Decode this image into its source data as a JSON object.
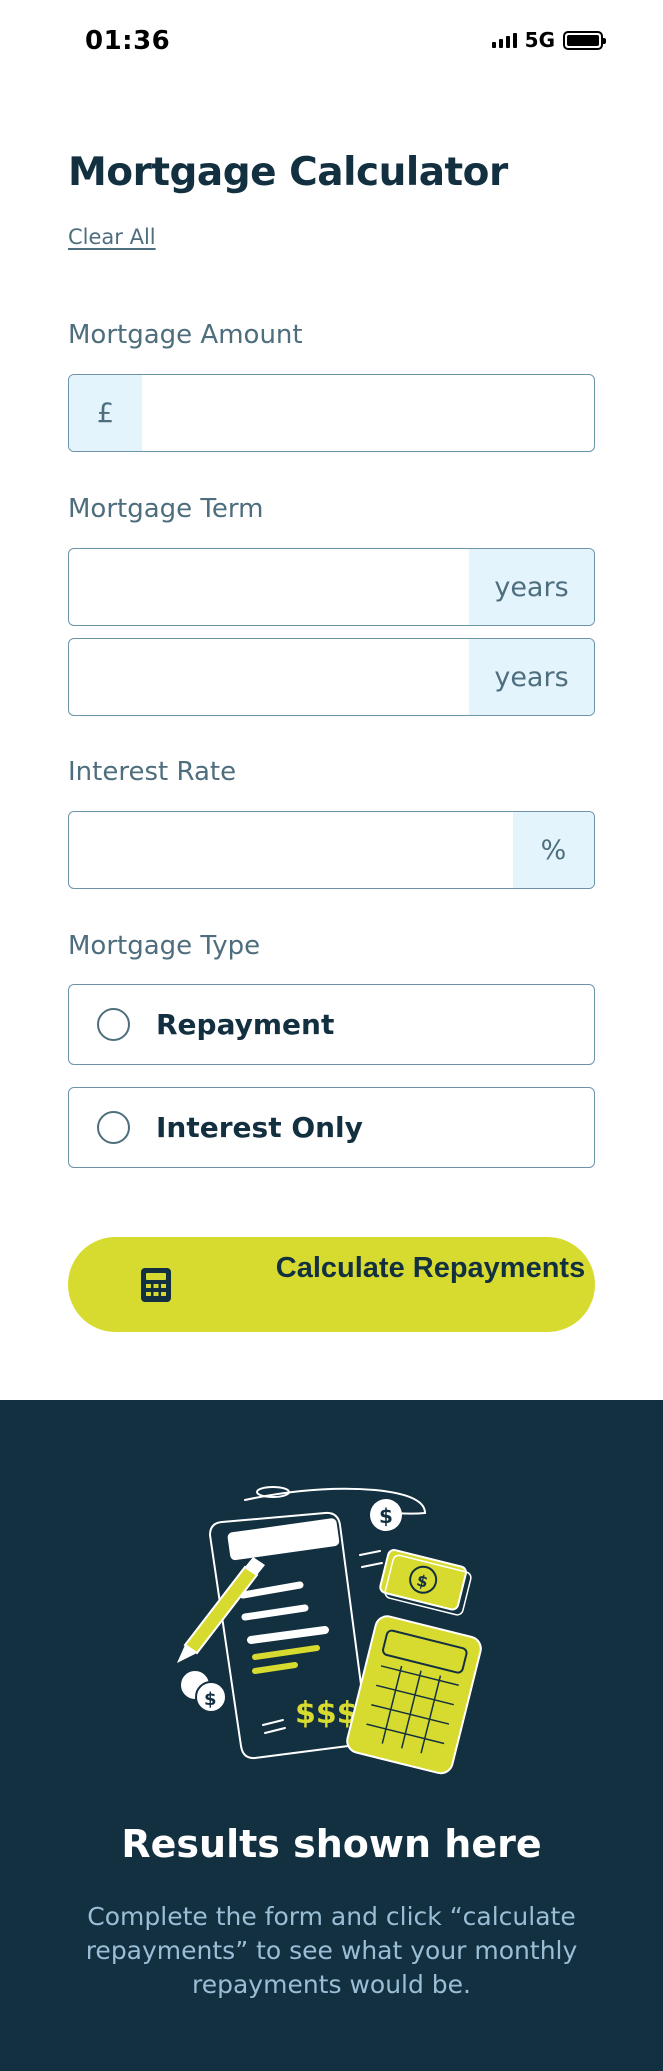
{
  "status_bar": {
    "time": "01:36",
    "network": "5G"
  },
  "header": {
    "title": "Mortgage Calculator",
    "clear_label": "Clear All"
  },
  "amount": {
    "label": "Mortgage Amount",
    "prefix": "£",
    "value": ""
  },
  "term": {
    "label": "Mortgage Term",
    "suffix": "years",
    "value": "",
    "value2": ""
  },
  "rate": {
    "label": "Interest Rate",
    "suffix": "%",
    "value": ""
  },
  "type": {
    "label": "Mortgage Type",
    "options": [
      {
        "label": "Repayment",
        "selected": false
      },
      {
        "label": "Interest Only",
        "selected": false
      }
    ]
  },
  "submit": {
    "label": "Calculate Repayments",
    "icon": "calculator-icon"
  },
  "results": {
    "title": "Results shown here",
    "text": "Complete the form and click “calculate repayments” to see what your monthly repayments would be.",
    "illustration": "empty-results-illustration"
  },
  "colors": {
    "primary": "#133041",
    "accent": "#d8db2f",
    "addon_bg": "#e4f4fd",
    "muted": "#4e6e7e"
  }
}
